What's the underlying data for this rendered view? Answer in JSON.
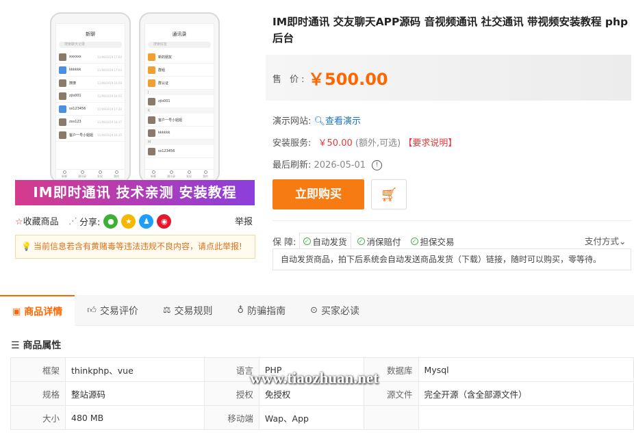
{
  "gallery": {
    "phone1": {
      "title": "新聊",
      "search": "搜索聊天记录",
      "rows": [
        {
          "name": "xxxxxx",
          "time": "11/09/2019 17:04"
        },
        {
          "name": "kkkkkk",
          "time": "11/09/2019 17:03"
        },
        {
          "name": "撩撩",
          "time": "11/09/2019 16:59"
        },
        {
          "name": "zjis001",
          "time": "11/09/2019 16:55"
        },
        {
          "name": "ss123456",
          "time": "11/09/2019 17:22"
        },
        {
          "name": "zxs123",
          "time": "11/09/2019 16:37"
        },
        {
          "name": "客户一号小姐姐",
          "time": "11/09/2019 16:35"
        }
      ],
      "nav": [
        "新聊",
        "通讯录",
        "发现",
        "我的"
      ]
    },
    "phone2": {
      "title": "通讯录",
      "search": "搜索好友",
      "items": [
        "新的朋友",
        "群组",
        "群认证"
      ],
      "sections": [
        "J",
        "K",
        "M"
      ],
      "contacts": [
        "zjis001",
        "客户一号小姐姐",
        "kkkkkk",
        "ss123456"
      ],
      "nav": [
        "新聊",
        "通讯录",
        "发现",
        "我的"
      ]
    },
    "banner": "IM即时通讯 技术亲测 安装教程"
  },
  "actions": {
    "favorite": "收藏商品",
    "share": "分享:",
    "report": "举报"
  },
  "warning": "当前信息若含有黄赌毒等违法违规不良内容，请点此举报!",
  "product": {
    "title": "IM即时通讯 交友聊天APP源码 音视频通讯 社交通讯 带视频安装教程 php后台",
    "price_label": "售 价:",
    "price": "￥500.00",
    "demo_label": "演示网站:",
    "demo_link": "查看演示",
    "install_label": "安装服务:",
    "install_price": "￥50.00",
    "install_note": "(额外,可选)",
    "install_req": "【要求说明】",
    "refresh_label": "最后刷新:",
    "refresh_date": "2026-05-01",
    "buy_button": "立即购买",
    "guarantee_label": "保 障:",
    "guarantees": [
      "自动发货",
      "消保赔付",
      "担保交易"
    ],
    "pay_method": "支付方式",
    "guarantee_desc": "自动发货商品，拍下后系统会自动发送商品发货（下载）链接，随时可以购买，零等待。"
  },
  "tabs": [
    "商品详情",
    "交易评价",
    "交易规则",
    "防骗指南",
    "买家必读"
  ],
  "attributes": {
    "heading": "商品属性",
    "rows": [
      [
        {
          "k": "框架",
          "v": "thinkphp、vue"
        },
        {
          "k": "语言",
          "v": "PHP"
        },
        {
          "k": "数据库",
          "v": "Mysql"
        }
      ],
      [
        {
          "k": "规格",
          "v": "整站源码"
        },
        {
          "k": "授权",
          "v": "免授权"
        },
        {
          "k": "源文件",
          "v": "完全开源（含全部源文件）"
        }
      ],
      [
        {
          "k": "大小",
          "v": "480 MB"
        },
        {
          "k": "移动端",
          "v": "Wap、App"
        },
        {
          "k": "",
          "v": ""
        }
      ]
    ]
  },
  "watermark": "www.tiaozhuan.net",
  "colors": {
    "accent": "#f67b12",
    "price": "#ff6600",
    "link": "#1a73c9",
    "danger": "#e4393c"
  }
}
